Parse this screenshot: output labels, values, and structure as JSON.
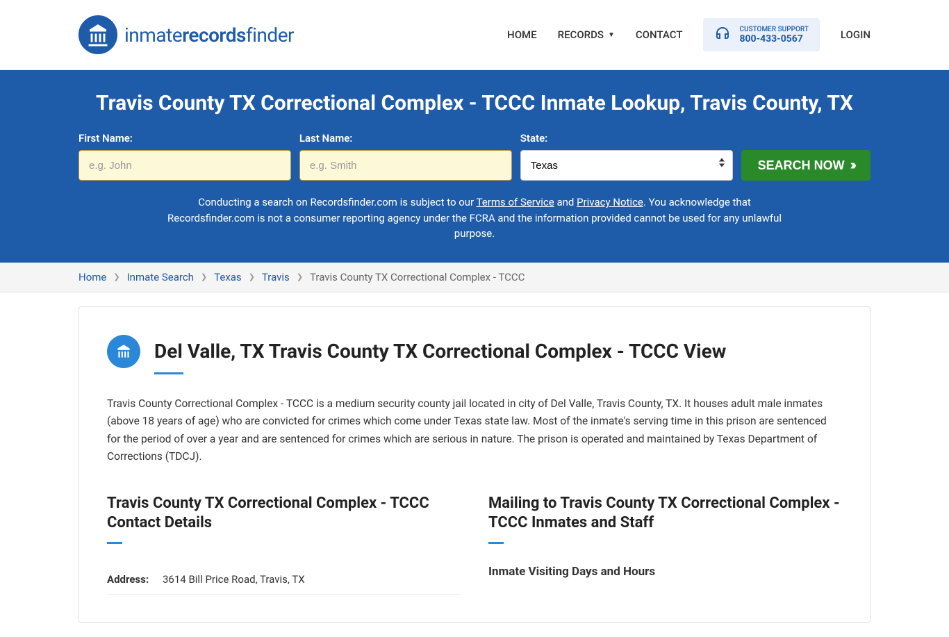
{
  "header": {
    "logo_text_1": "inmate",
    "logo_text_2": "records",
    "logo_text_3": "finder",
    "nav": {
      "home": "HOME",
      "records": "RECORDS",
      "contact": "CONTACT",
      "login": "LOGIN"
    },
    "support": {
      "label": "CUSTOMER SUPPORT",
      "phone": "800-433-0567"
    }
  },
  "hero": {
    "title": "Travis County TX Correctional Complex - TCCC Inmate Lookup, Travis County, TX",
    "form": {
      "first_name_label": "First Name:",
      "first_name_placeholder": "e.g. John",
      "last_name_label": "Last Name:",
      "last_name_placeholder": "e.g. Smith",
      "state_label": "State:",
      "state_value": "Texas",
      "button": "SEARCH NOW"
    },
    "disclaimer": {
      "text_1": "Conducting a search on Recordsfinder.com is subject to our ",
      "tos": "Terms of Service",
      "text_2": " and ",
      "privacy": "Privacy Notice",
      "text_3": ". You acknowledge that Recordsfinder.com is not a consumer reporting agency under the FCRA and the information provided cannot be used for any unlawful purpose."
    }
  },
  "breadcrumb": {
    "items": [
      "Home",
      "Inmate Search",
      "Texas",
      "Travis"
    ],
    "current": "Travis County TX Correctional Complex - TCCC"
  },
  "panel": {
    "title": "Del Valle, TX Travis County TX Correctional Complex - TCCC View",
    "description": "Travis County Correctional Complex - TCCC is a medium security county jail located in city of Del Valle, Travis County, TX. It houses adult male inmates (above 18 years of age) who are convicted for crimes which come under Texas state law. Most of the inmate's serving time in this prison are sentenced for the period of over a year and are sentenced for crimes which are serious in nature. The prison is operated and maintained by Texas Department of Corrections (TDCJ).",
    "contact": {
      "heading": "Travis County TX Correctional Complex - TCCC Contact Details",
      "address_label": "Address:",
      "address_value": "3614 Bill Price Road, Travis, TX"
    },
    "mailing": {
      "heading": "Mailing to Travis County TX Correctional Complex - TCCC Inmates and Staff",
      "visiting_heading": "Inmate Visiting Days and Hours"
    }
  }
}
